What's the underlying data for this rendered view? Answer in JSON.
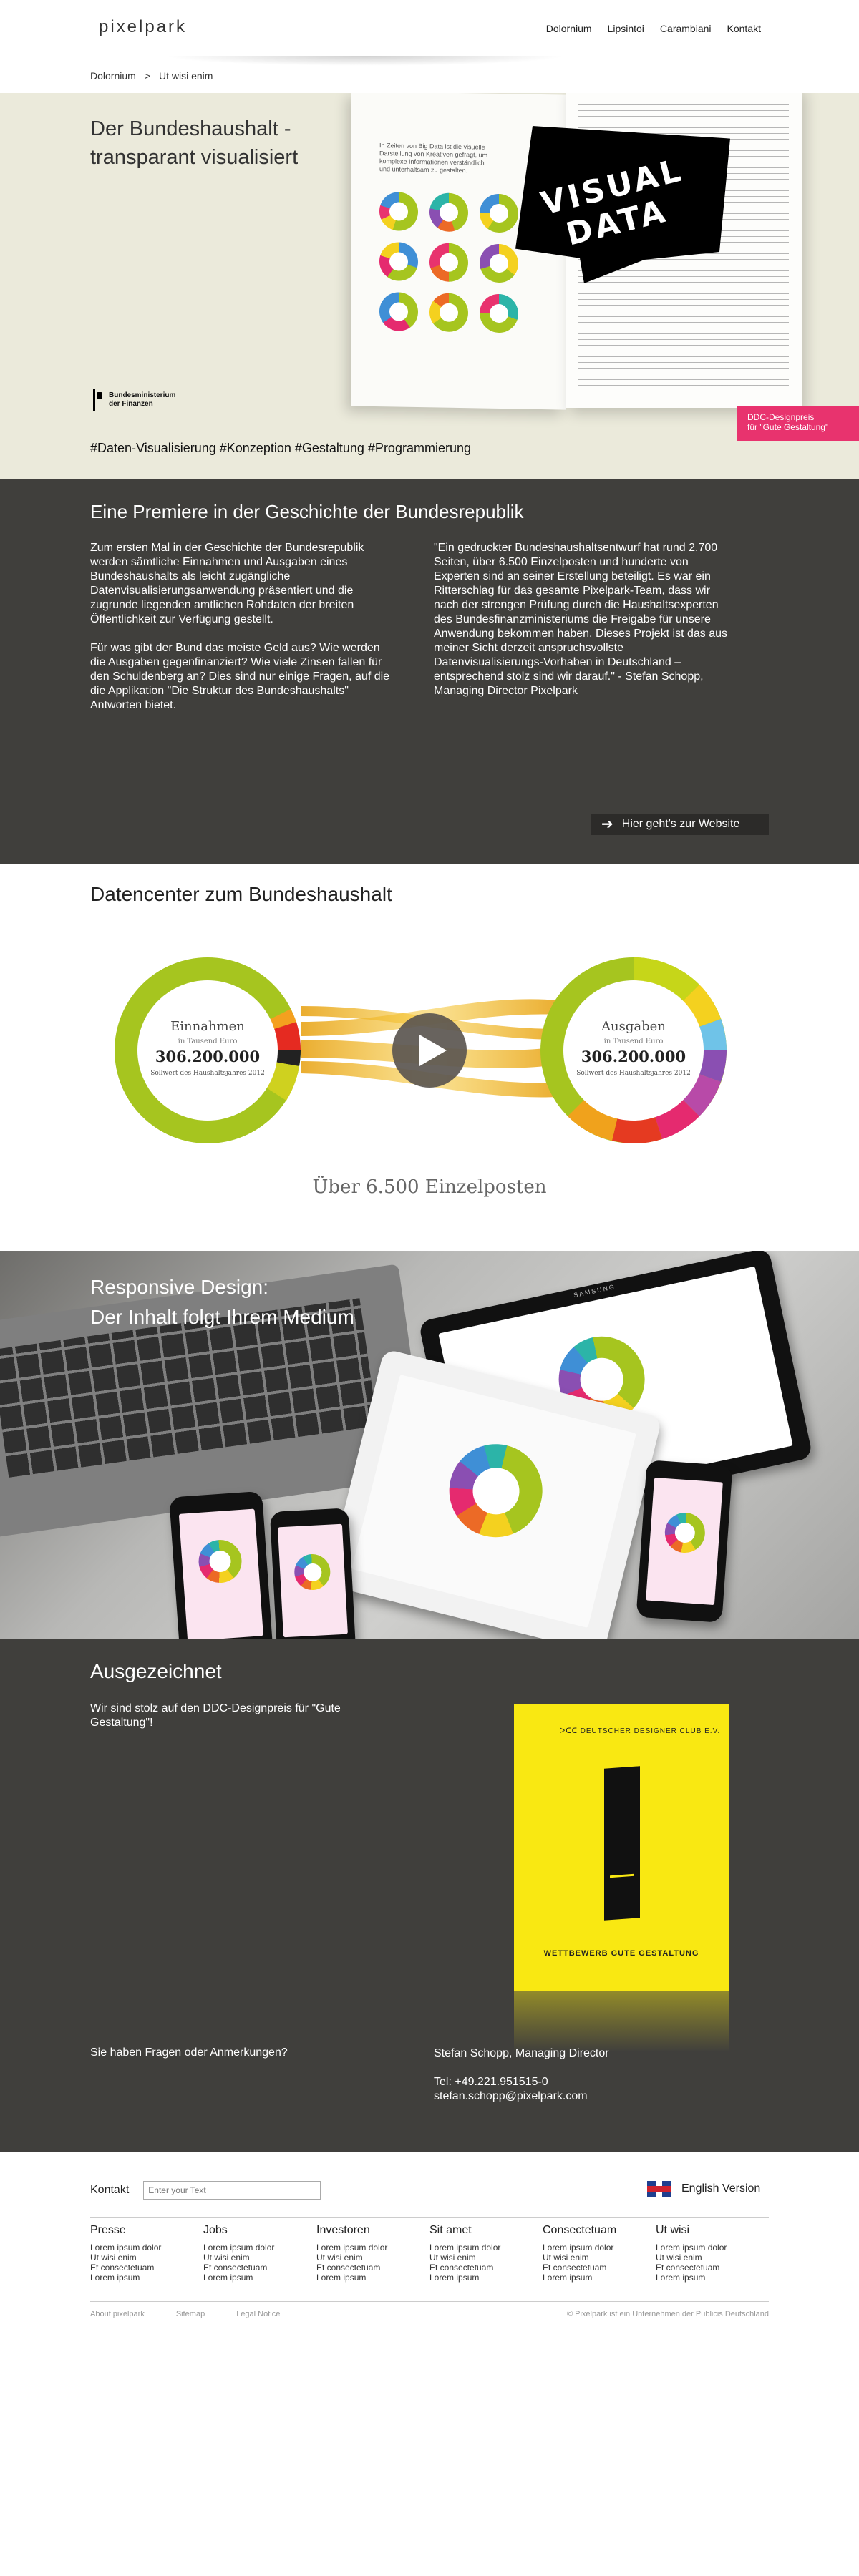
{
  "header": {
    "logo": "pixelpark",
    "nav": [
      "Dolornium",
      "Lipsintoi",
      "Carambiani",
      "Kontakt"
    ]
  },
  "breadcrumb": {
    "items": [
      "Dolornium",
      ">",
      "Ut wisi enim"
    ]
  },
  "hero": {
    "title": "Der Bundeshaushalt - transparant visualisiert",
    "tags": "#Daten-Visualisierung #Konzeption #Gestaltung #Programmierung",
    "ministry": [
      "Bundesministerium",
      "der Finanzen"
    ],
    "book_intro": "In Zeiten von Big Data ist die visuelle Darstellung von Kreativen gefragt, um komplexe Informationen verständlich und unterhaltsam zu gestalten.",
    "visual_data": [
      "VISUAL",
      "DATA"
    ],
    "ddc_badge": [
      "DDC-Designpreis",
      "für \"Gute Gestaltung\""
    ],
    "colors": {
      "badge": "#e8336e",
      "background": "#ebeadb"
    }
  },
  "premiere": {
    "title": "Eine Premiere in der Geschichte der Bundesrepublik",
    "left_p1": "Zum ersten Mal in der Geschichte der Bundesrepublik werden sämtliche Einnahmen und Ausgaben eines Bundeshaushalts als leicht zugängliche Datenvisualisierungsanwendung präsentiert und die zugrunde liegenden amtlichen Rohdaten der breiten Öffentlichkeit zur Verfügung gestellt.",
    "left_p2": "Für was gibt der Bund das meiste Geld aus? Wie werden die Ausgaben gegenfinanziert? Wie viele Zinsen fallen für den Schuldenberg an? Dies sind nur einige Fragen, auf die die Applikation \"Die Struktur des Bundeshaushalts\" Antworten bietet.",
    "quote": "\"Ein gedruckter Bundeshaushaltsentwurf hat rund 2.700 Seiten, über 6.500 Einzelposten und hunderte von Experten sind an seiner Erstellung beteiligt. Es war ein Ritterschlag für das gesamte Pixelpark-Team, dass wir nach der strengen Prüfung durch die Haushaltsexperten des Bundesfinanzministeriums die Freigabe für unsere Anwendung bekommen haben. Dieses Projekt ist das aus meiner Sicht derzeit anspruchsvollste Datenvisualisierungs-Vorhaben in Deutschland – entsprechend stolz sind wir darauf.\" - Stefan Schopp, Managing Director Pixelpark",
    "button": "Hier geht's zur Website",
    "arrow_icon": "arrow-right-icon",
    "colors": {
      "background": "#403f3c",
      "button": "#2c2b29"
    }
  },
  "datacenter": {
    "title": "Datencenter zum Bundeshaushalt",
    "left": {
      "title": "Einnahmen",
      "unit": "in Tausend Euro",
      "value": "306.200.000",
      "note": "Sollwert des Haushaltsjahres 2012"
    },
    "right": {
      "title": "Ausgaben",
      "unit": "in Tausend Euro",
      "value": "306.200.000",
      "note": "Sollwert des Haushaltsjahres 2012"
    },
    "caption": "Über 6.500 Einzelposten",
    "play_icon": "play-icon",
    "colors": {
      "lime": "#a6c51f",
      "flow": "#f0b21c",
      "play": "#5b5650"
    }
  },
  "responsive": {
    "title": [
      "Responsive Design:",
      "Der Inhalt folgt Ihrem Medium"
    ],
    "tablet_brand": "SAMSUNG"
  },
  "award": {
    "title": "Ausgezeichnet",
    "text": "Wir sind stolz auf den DDC-Designpreis für \"Gute Gestaltung\"!",
    "poster_logo": "ᐳᑕᑕ  DEUTSCHER DESIGNER CLUB E.V.",
    "poster_caption": "WETTBEWERB GUTE GESTALTUNG",
    "questions": "Sie haben Fragen oder Anmerkungen?",
    "contact_name": "Stefan Schopp, Managing Director",
    "contact_tel": "Tel:  +49.221.951515-0",
    "contact_email": "stefan.schopp@pixelpark.com",
    "colors": {
      "poster": "#f9e812"
    }
  },
  "footer": {
    "contact_label": "Kontakt",
    "input_placeholder": "Enter your Text",
    "english": "English Version",
    "flag_icon": "uk-flag-icon",
    "columns": [
      {
        "title": "Presse",
        "items": [
          "Lorem ipsum dolor",
          "Ut wisi enim",
          "Et consectetuam",
          "Lorem ipsum"
        ]
      },
      {
        "title": "Jobs",
        "items": [
          "Lorem ipsum dolor",
          "Ut wisi enim",
          "Et consectetuam",
          "Lorem ipsum"
        ]
      },
      {
        "title": "Investoren",
        "items": [
          "Lorem ipsum dolor",
          "Ut wisi enim",
          "Et consectetuam",
          "Lorem ipsum"
        ]
      },
      {
        "title": "Sit amet",
        "items": [
          "Lorem ipsum dolor",
          "Ut wisi enim",
          "Et consectetuam",
          "Lorem ipsum"
        ]
      },
      {
        "title": "Consectetuam",
        "items": [
          "Lorem ipsum dolor",
          "Ut wisi enim",
          "Et consectetuam",
          "Lorem ipsum"
        ]
      },
      {
        "title": "Ut wisi",
        "items": [
          "Lorem ipsum dolor",
          "Ut wisi enim",
          "Et consectetuam",
          "Lorem ipsum"
        ]
      }
    ],
    "bottom_links": [
      "About pixelpark",
      "Sitemap",
      "Legal Notice"
    ],
    "copyright": "© Pixelpark ist ein Unternehmen der Publicis Deutschland"
  }
}
